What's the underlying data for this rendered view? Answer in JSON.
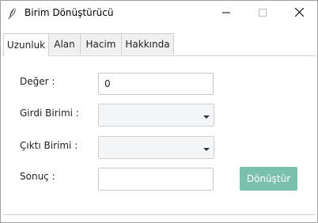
{
  "window": {
    "title": "Birim Dönüştürücü",
    "app_icon": "feather-icon",
    "controls": {
      "minimize": "minimize-icon",
      "maximize": "maximize-icon",
      "close": "close-icon"
    }
  },
  "tabs": [
    {
      "label": "Uzunluk",
      "active": true
    },
    {
      "label": "Alan",
      "active": false
    },
    {
      "label": "Hacim",
      "active": false
    },
    {
      "label": "Hakkında",
      "active": false
    }
  ],
  "form": {
    "value_label": "Değer :",
    "value": "0",
    "input_unit_label": "Girdi Birimi :",
    "input_unit_selected": "",
    "output_unit_label": "Çıktı Birimi :",
    "output_unit_selected": "",
    "result_label": "Sonuç :",
    "result_value": "",
    "convert_label": "Dönüştür"
  },
  "colors": {
    "accent_button": "#7ac0ab",
    "combo_background": "#f4f5f7",
    "border": "#c8c8c8"
  }
}
